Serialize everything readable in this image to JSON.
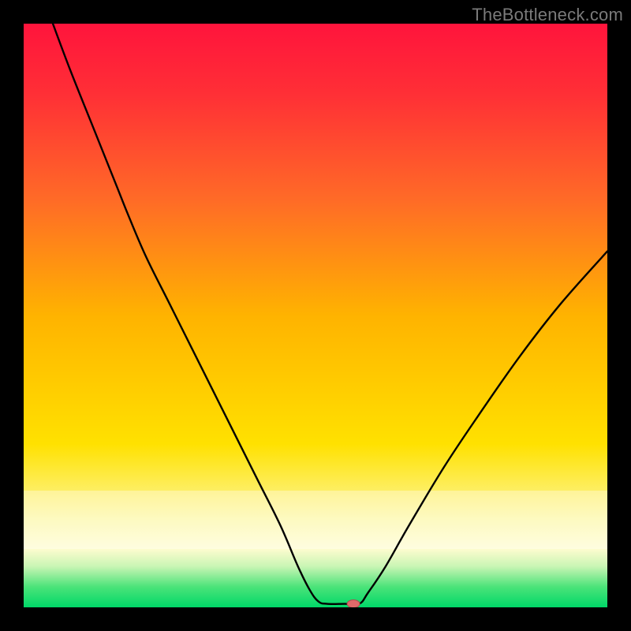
{
  "watermark": "TheBottleneck.com",
  "chart_data": {
    "type": "line",
    "title": "",
    "xlabel": "",
    "ylabel": "",
    "xlim": [
      0,
      100
    ],
    "ylim": [
      0,
      100
    ],
    "background_gradient": {
      "stops": [
        {
          "offset": 0.0,
          "color": "#ff143c"
        },
        {
          "offset": 0.12,
          "color": "#ff2f36"
        },
        {
          "offset": 0.3,
          "color": "#ff6a27"
        },
        {
          "offset": 0.5,
          "color": "#ffb300"
        },
        {
          "offset": 0.72,
          "color": "#ffe100"
        },
        {
          "offset": 0.85,
          "color": "#fcf7a0"
        },
        {
          "offset": 0.9,
          "color": "#fdfccf"
        },
        {
          "offset": 0.93,
          "color": "#c9f5b4"
        },
        {
          "offset": 0.965,
          "color": "#4be379"
        },
        {
          "offset": 1.0,
          "color": "#00d868"
        }
      ],
      "pale_band": {
        "y_from": 80,
        "y_to": 90,
        "opacity": 0.35
      }
    },
    "series": [
      {
        "name": "bottleneck-curve",
        "color": "#000000",
        "width": 2.4,
        "points": [
          {
            "x": 5.0,
            "y": 100.0
          },
          {
            "x": 8.0,
            "y": 92.0
          },
          {
            "x": 12.0,
            "y": 82.0
          },
          {
            "x": 16.0,
            "y": 72.0
          },
          {
            "x": 18.0,
            "y": 67.0
          },
          {
            "x": 21.0,
            "y": 60.0
          },
          {
            "x": 25.0,
            "y": 52.0
          },
          {
            "x": 30.0,
            "y": 42.0
          },
          {
            "x": 35.0,
            "y": 32.0
          },
          {
            "x": 40.0,
            "y": 22.0
          },
          {
            "x": 44.0,
            "y": 14.0
          },
          {
            "x": 47.0,
            "y": 7.0
          },
          {
            "x": 49.0,
            "y": 3.0
          },
          {
            "x": 50.5,
            "y": 1.0
          },
          {
            "x": 52.0,
            "y": 0.6
          },
          {
            "x": 55.0,
            "y": 0.6
          },
          {
            "x": 57.5,
            "y": 0.6
          },
          {
            "x": 59.0,
            "y": 2.5
          },
          {
            "x": 62.0,
            "y": 7.0
          },
          {
            "x": 66.0,
            "y": 14.0
          },
          {
            "x": 72.0,
            "y": 24.0
          },
          {
            "x": 78.0,
            "y": 33.0
          },
          {
            "x": 85.0,
            "y": 43.0
          },
          {
            "x": 92.0,
            "y": 52.0
          },
          {
            "x": 100.0,
            "y": 61.0
          }
        ]
      }
    ],
    "marker": {
      "name": "optimum-marker",
      "x": 56.5,
      "y": 0.6,
      "rx": 8,
      "ry": 5,
      "fill": "#e26a6a",
      "stroke": "#b04e4e"
    }
  }
}
